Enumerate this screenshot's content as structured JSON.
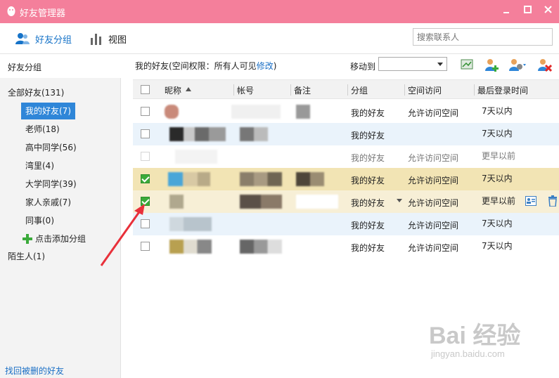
{
  "window": {
    "title": "好友管理器"
  },
  "toolbar": {
    "groups_label": "好友分组",
    "view_label": "视图",
    "search_placeholder": "搜索联系人"
  },
  "sidebar": {
    "header": "好友分组",
    "items": [
      {
        "label": "全部好友(131)"
      },
      {
        "label": "我的好友(7)",
        "active": true
      },
      {
        "label": "老师(18)"
      },
      {
        "label": "高中同学(56)"
      },
      {
        "label": "湾里(4)"
      },
      {
        "label": "大学同学(39)"
      },
      {
        "label": "家人亲戚(7)"
      },
      {
        "label": "同事(0)"
      },
      {
        "label": "点击添加分组"
      },
      {
        "label": "陌生人(1)"
      }
    ],
    "restore_link": "找回被删的好友"
  },
  "main": {
    "info_prefix": "我的好友(空间权限：所有人可见",
    "info_link": "修改",
    "info_suffix": ")",
    "move_to_label": "移动到",
    "columns": [
      "昵称",
      "帐号",
      "备注",
      "分组",
      "空间访问",
      "最后登录时间"
    ],
    "rows": [
      {
        "group": "我的好友",
        "space": "允许访问空间",
        "last_login": "7天以内",
        "checked": false
      },
      {
        "group": "我的好友",
        "space": "",
        "last_login": "7天以内",
        "checked": false
      },
      {
        "group": "我的好友",
        "space": "允许访问空间",
        "last_login": "更早以前",
        "checked": false
      },
      {
        "group": "我的好友",
        "space": "允许访问空间",
        "last_login": "7天以内",
        "checked": true
      },
      {
        "group": "我的好友",
        "space": "允许访问空间",
        "last_login": "更早以前",
        "checked": true
      },
      {
        "group": "我的好友",
        "space": "允许访问空间",
        "last_login": "7天以内",
        "checked": false
      },
      {
        "group": "我的好友",
        "space": "允许访问空间",
        "last_login": "7天以内",
        "checked": false
      }
    ]
  },
  "colors": {
    "titlebar": "#f47f9b",
    "accent": "#2f86d8",
    "row_highlight": "#f2e4b4",
    "row_alt": "#eaf3fb",
    "annotation": "#e8303a"
  },
  "watermark": {
    "text": "Bai 经验",
    "sub": "jingyan.baidu.com"
  }
}
